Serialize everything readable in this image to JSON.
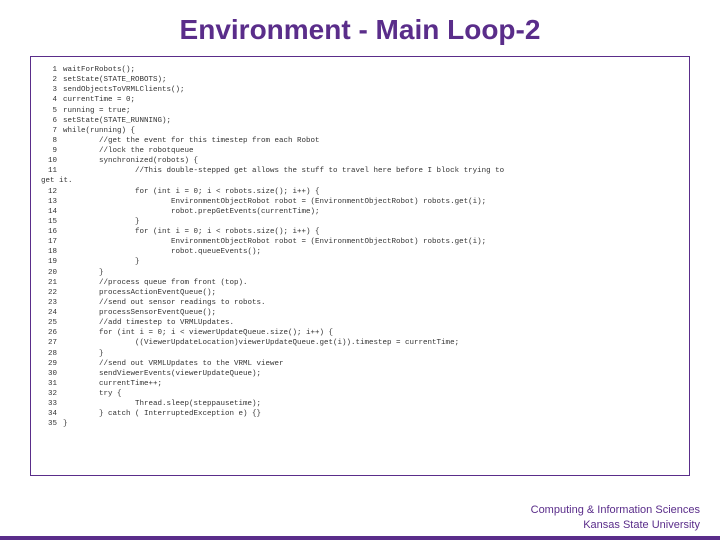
{
  "title": "Environment - Main Loop-2",
  "code_lines": [
    "waitForRobots();",
    "setState(STATE_ROBOTS);",
    "sendObjectsToVRMLClients();",
    "currentTime = 0;",
    "running = true;",
    "setState(STATE_RUNNING);",
    "while(running) {",
    "        //get the event for this timestep from each Robot",
    "        //lock the robotqueue",
    "        synchronized(robots) {",
    "                //This double-stepped get allows the stuff to travel here before I block trying to",
    "get it.",
    "                for (int i = 0; i < robots.size(); i++) {",
    "                        EnvironmentObjectRobot robot = (EnvironmentObjectRobot) robots.get(i);",
    "                        robot.prepGetEvents(currentTime);",
    "                }",
    "                for (int i = 0; i < robots.size(); i++) {",
    "                        EnvironmentObjectRobot robot = (EnvironmentObjectRobot) robots.get(i);",
    "                        robot.queueEvents();",
    "                }",
    "        }",
    "        //process queue from front (top).",
    "        processActionEventQueue();",
    "        //send out sensor readings to robots.",
    "        processSensorEventQueue();",
    "        //add timestep to VRMLUpdates.",
    "        for (int i = 0; i < viewerUpdateQueue.size(); i++) {",
    "                ((ViewerUpdateLocation)viewerUpdateQueue.get(i)).timestep = currentTime;",
    "        }",
    "        //send out VRMLUpdates to the VRML viewer",
    "        sendViewerEvents(viewerUpdateQueue);",
    "        currentTime++;",
    "        try {",
    "                Thread.sleep(steppausetime);",
    "        } catch ( InterruptedException e) {}",
    "}"
  ],
  "line_numbers_with_breaks": {
    "11_continuation": "get it."
  },
  "footer": {
    "line1": "Computing & Information Sciences",
    "line2": "Kansas State University"
  }
}
